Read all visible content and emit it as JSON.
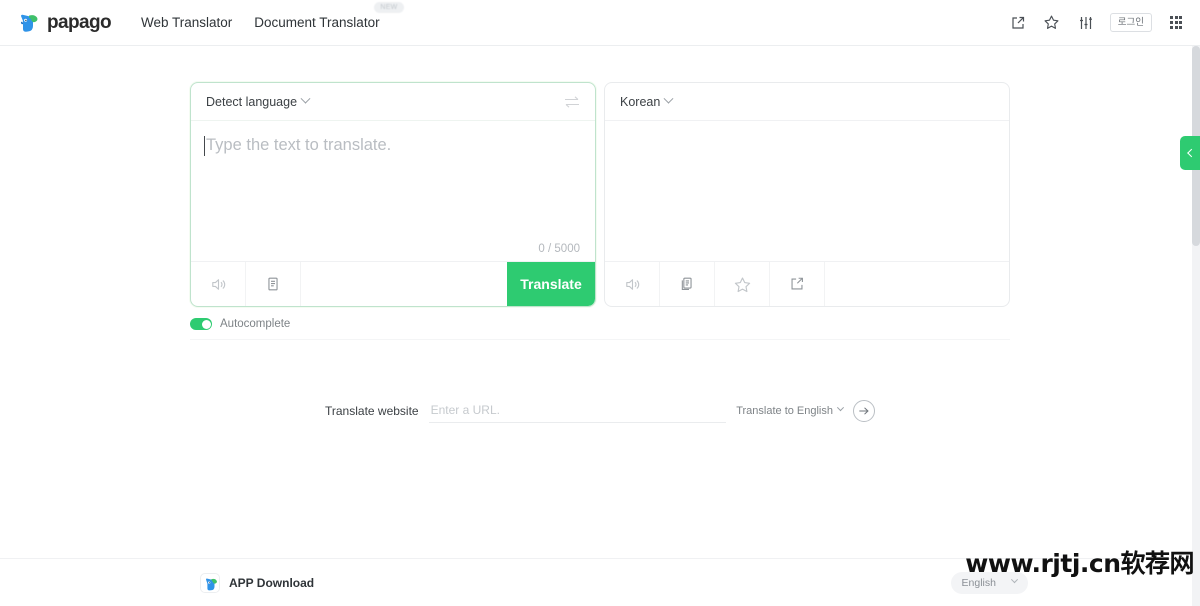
{
  "nav": {
    "brand_name": "papago",
    "links": [
      {
        "label": "Web Translator",
        "badge": ""
      },
      {
        "label": "Document Translator",
        "badge": "NEW"
      }
    ],
    "icons": [
      {
        "name": "share-icon"
      },
      {
        "name": "star-icon"
      },
      {
        "name": "sliders-icon"
      }
    ],
    "login_label": "로그인",
    "apps_icon": "grid-apps-icon"
  },
  "translator": {
    "source": {
      "language": "Detect language",
      "placeholder": "Type the text to translate.",
      "value": "",
      "counter": "0 / 5000",
      "tools": [
        {
          "name": "speaker-icon"
        },
        {
          "name": "copy-icon"
        }
      ],
      "translate_button": "Translate"
    },
    "target": {
      "language": "Korean",
      "value": "",
      "tools": [
        {
          "name": "speaker-icon"
        },
        {
          "name": "copy-icon"
        },
        {
          "name": "star-icon"
        },
        {
          "name": "share-icon"
        }
      ]
    },
    "swap_icon": "swap-languages-icon",
    "autocomplete": {
      "label": "Autocomplete",
      "enabled": true
    }
  },
  "website_translate": {
    "label": "Translate website",
    "url_placeholder": "Enter a URL.",
    "url_value": "",
    "target_language": "Translate to English",
    "go_icon": "arrow-right-icon"
  },
  "side_tab": {
    "icon": "chevron-left-icon"
  },
  "footer": {
    "app_download_label": "APP Download",
    "language": "English"
  },
  "watermark": {
    "text": "www.rjtj.cn软荐网"
  },
  "colors": {
    "accent_green": "#2ecb71",
    "brand_blue": "#2f93e8",
    "text_primary": "#2f3438",
    "text_muted": "#b9bdc2",
    "border": "#e9ebed",
    "source_border": "#bfe3cd"
  }
}
